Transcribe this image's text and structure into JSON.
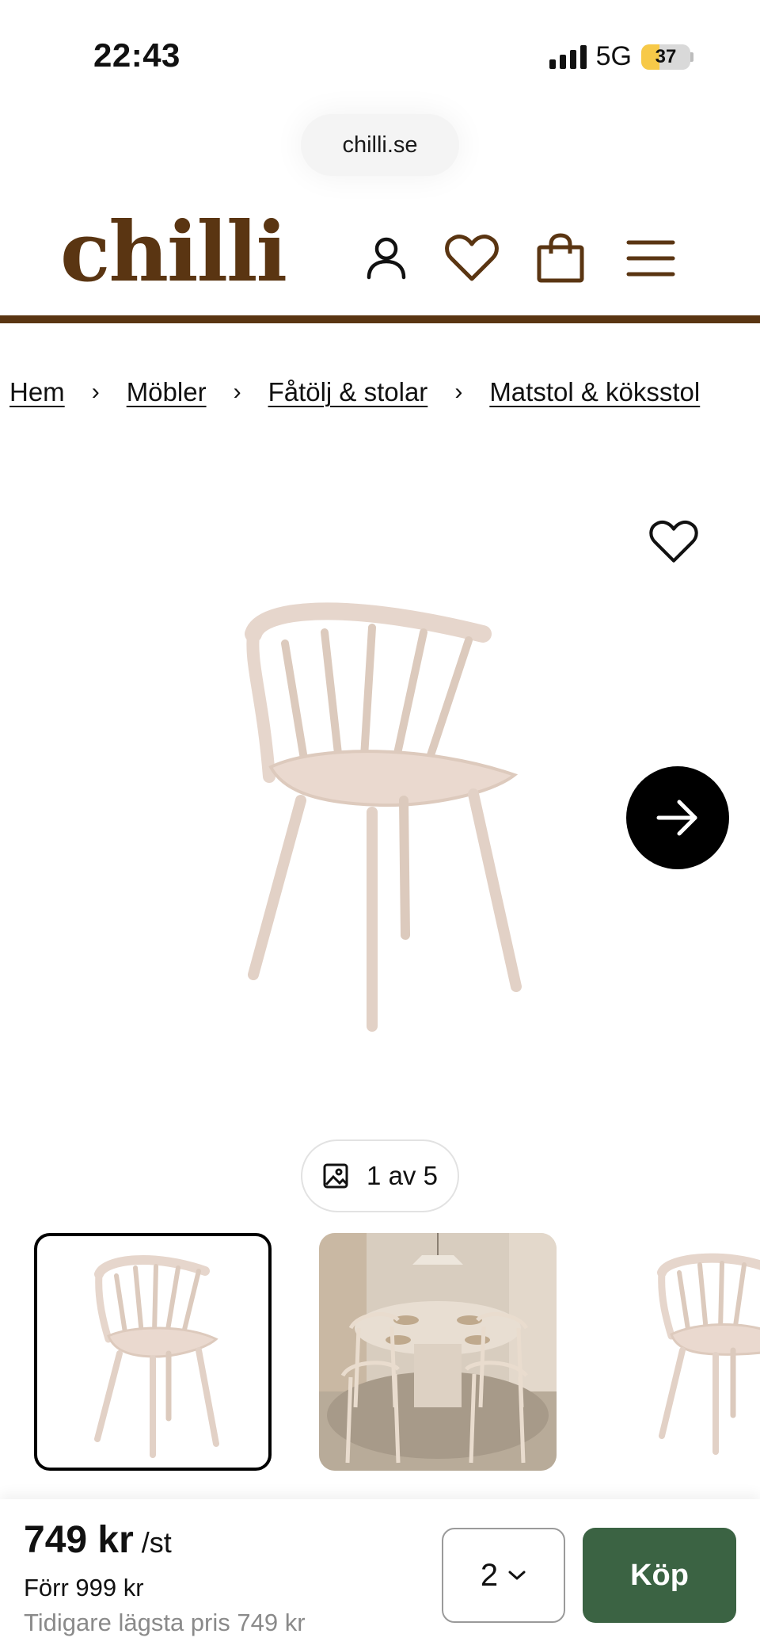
{
  "status_bar": {
    "time": "22:43",
    "network": "5G",
    "battery": "37",
    "battery_fraction": 0.37
  },
  "browser": {
    "url": "chilli.se"
  },
  "header": {
    "logo": "chilli",
    "brand_color": "#5a3512",
    "icons": [
      "user-icon",
      "heart-icon",
      "shopping-bag-icon",
      "menu-icon"
    ]
  },
  "breadcrumb": {
    "items": [
      {
        "label": "Hem"
      },
      {
        "label": "Möbler"
      },
      {
        "label": "Fåtölj & stolar"
      },
      {
        "label": "Matstol & köksstol"
      }
    ],
    "separator": "›"
  },
  "gallery": {
    "counter": "1 av 5",
    "thumbnails": [
      "chair-thumbnail",
      "dining-room-thumbnail",
      "chair-thumbnail-partial"
    ],
    "selected_index": 0
  },
  "purchase": {
    "price": "749 kr",
    "unit": "/st",
    "old_price": "Förr 999 kr",
    "lowest_price": "Tidigare lägsta pris 749 kr",
    "quantity": "2",
    "buy_label": "Köp",
    "buy_color": "#3b6343"
  }
}
